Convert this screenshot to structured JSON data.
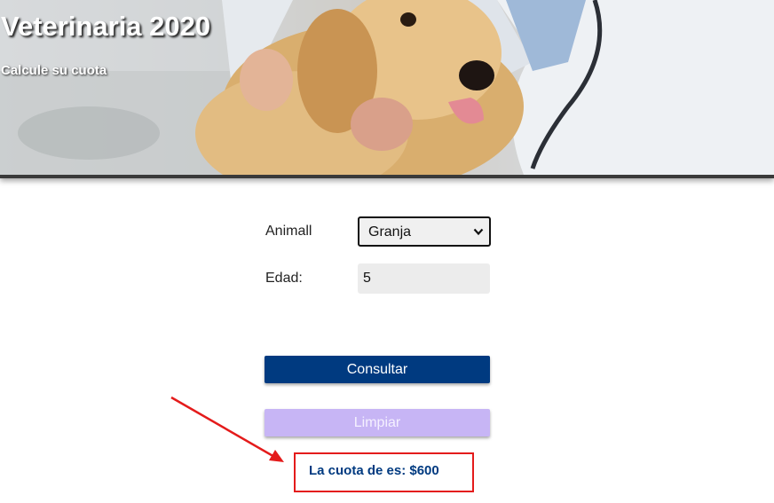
{
  "header": {
    "title": "Veterinaria 2020",
    "subtitle": "Calcule su cuota"
  },
  "form": {
    "animal_label": "Animall",
    "animal_selected": "Granja",
    "edad_label": "Edad:",
    "edad_value": "5"
  },
  "buttons": {
    "consultar": "Consultar",
    "limpiar": "Limpiar"
  },
  "result": {
    "text": "La cuota de es: $600"
  },
  "colors": {
    "primary_button": "#003a80",
    "disabled_button": "#c7b5f5",
    "annotation": "#e41b1b",
    "result_text": "#003a80"
  },
  "icons": {
    "select_chevron": "chevron-down-icon",
    "annotation_arrow": "red-arrow-icon",
    "hero_image": "vet-with-dog-photo"
  }
}
